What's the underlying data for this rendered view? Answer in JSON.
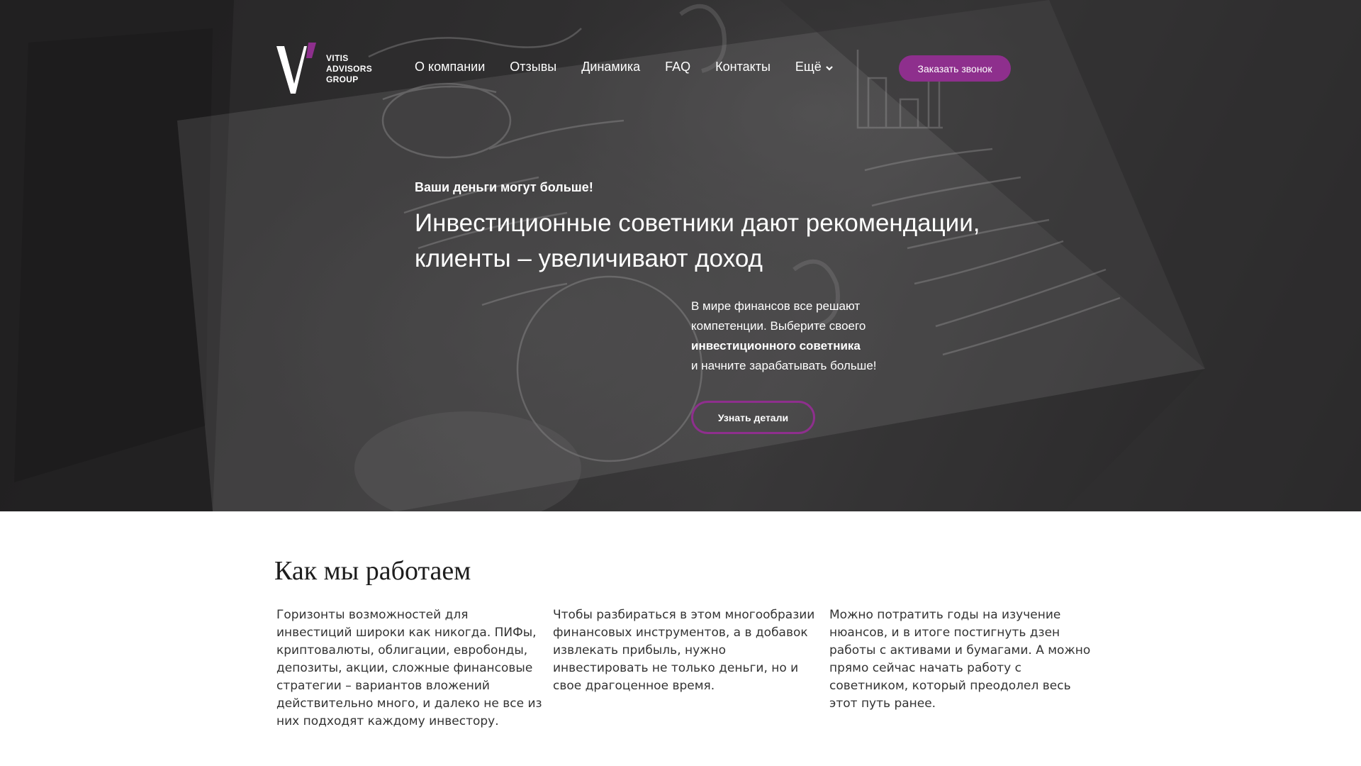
{
  "brand": {
    "logo_lines": [
      "VITIS",
      "ADVISORS",
      "GROUP"
    ],
    "accent_color": "#8e2f8d"
  },
  "nav": {
    "items": [
      "О компании",
      "Отзывы",
      "Динамика",
      "FAQ",
      "Контакты"
    ],
    "more_label": "Ещё",
    "call_button": "Заказать звонок"
  },
  "hero": {
    "tagline": "Ваши деньги могут больше!",
    "title_lines": [
      "Инвестиционные советники дают рекомендации,",
      "клиенты – увеличивают доход"
    ],
    "description_lines": [
      "В мире финансов все решают",
      "компетенции. Выберите своего",
      "инвестиционного советника",
      "и начните зарабатывать больше!"
    ],
    "details_button": "Узнать детали"
  },
  "how_we_work": {
    "title": "Как мы работаем",
    "columns": [
      [
        "Горизонты возможностей для",
        "инвестиций широки как никогда. ПИФы,",
        "криптовалюты, облигации, евробонды,",
        "депозиты, акции, сложные финансовые",
        "стратегии – вариантов вложений",
        "действительно много, и далеко не все из",
        "них подходят каждому инвестору."
      ],
      [
        "Чтобы разбираться в этом многообразии",
        "финансовых инструментов, а в добавок",
        "извлекать прибыль, нужно",
        "инвестировать не только деньги, но и",
        "свое драгоценное время."
      ],
      [
        "Можно потратить годы на изучение",
        "нюансов, и в итоге постигнуть дзен",
        "работы с активами и бумагами. А можно",
        "прямо сейчас начать работу с",
        "советником, который преодолел весь",
        "этот путь ранее."
      ]
    ]
  }
}
